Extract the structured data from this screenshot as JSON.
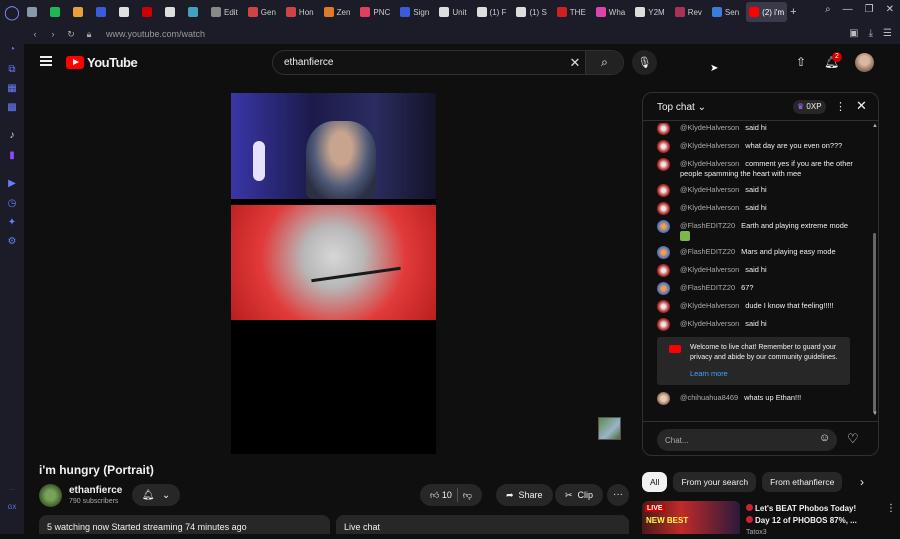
{
  "tabs": [
    {
      "label": "",
      "color": "#8899aa"
    },
    {
      "label": "",
      "color": "#1db954"
    },
    {
      "label": "",
      "color": "#e7a03a"
    },
    {
      "label": "",
      "color": "#3b5bdb"
    },
    {
      "label": "",
      "color": "#e0e0e0"
    },
    {
      "label": "",
      "color": "#cc0000"
    },
    {
      "label": "",
      "color": "#dddddd"
    },
    {
      "label": "",
      "color": "#44a0c0"
    },
    {
      "label": "Edit",
      "color": "#888888"
    },
    {
      "label": "Gen",
      "color": "#cc4444"
    },
    {
      "label": "Hon",
      "color": "#cc4444"
    },
    {
      "label": "Zen",
      "color": "#e07a2a"
    },
    {
      "label": "PNC",
      "color": "#e04060"
    },
    {
      "label": "Sign",
      "color": "#3b5bdb"
    },
    {
      "label": "Unit",
      "color": "#dddddd"
    },
    {
      "label": "(1) F",
      "color": "#dddddd"
    },
    {
      "label": "(1) S",
      "color": "#dddddd"
    },
    {
      "label": "THE",
      "color": "#cc2222"
    },
    {
      "label": "Wha",
      "color": "#dd44aa"
    },
    {
      "label": "Y2M",
      "color": "#dddddd"
    },
    {
      "label": "Rev",
      "color": "#aa3355"
    },
    {
      "label": "Sen",
      "color": "#3b7bdb"
    },
    {
      "label": "(2) i'm",
      "color": "#ff0000",
      "active": true
    }
  ],
  "browser": {
    "url": "www.youtube.com/watch",
    "new_tab": "+"
  },
  "header": {
    "logo_text": "YouTube",
    "search_query": "ethanfierce",
    "notification_count": "2"
  },
  "video": {
    "title": "i'm hungry (Portrait)",
    "channel_name": "ethanfierce",
    "subscribers": "790 subscribers",
    "like_count": "10",
    "share_label": "Share",
    "clip_label": "Clip",
    "stats_text": "5 watching now  Started streaming 74 minutes ago",
    "live_chat_label": "Live chat"
  },
  "chat": {
    "mode_label": "Top chat",
    "xp_label": "0XP",
    "input_placeholder": "Chat...",
    "messages": [
      {
        "author": "@KlydeHalverson",
        "text": "said hi",
        "avatar": "kh"
      },
      {
        "author": "@KlydeHalverson",
        "text": "what day are you even on???",
        "avatar": "kh"
      },
      {
        "author": "@KlydeHalverson",
        "text": "comment yes if you are the other people spamming the heart with mee",
        "avatar": "kh"
      },
      {
        "author": "@KlydeHalverson",
        "text": "said hi",
        "avatar": "kh"
      },
      {
        "author": "@KlydeHalverson",
        "text": "said hi",
        "avatar": "kh"
      },
      {
        "author": "@FlashEDITZ20",
        "text": "Earth and playing extreme mode",
        "avatar": "fe",
        "emoji": true
      },
      {
        "author": "@FlashEDITZ20",
        "text": "Mars and playing easy mode",
        "avatar": "fe"
      },
      {
        "author": "@KlydeHalverson",
        "text": "said hi",
        "avatar": "kh"
      },
      {
        "author": "@FlashEDITZ20",
        "text": "67?",
        "avatar": "fe"
      },
      {
        "author": "@KlydeHalverson",
        "text": "dude I know that feeling!!!!!",
        "avatar": "kh"
      },
      {
        "author": "@KlydeHalverson",
        "text": "said hi",
        "avatar": "kh"
      }
    ],
    "welcome_text": "Welcome to live chat! Remember to guard your privacy and abide by our community guidelines.",
    "learn_more": "Learn more",
    "last_message": {
      "author": "@chihuahua8469",
      "text": "whats up Ethan!!!",
      "avatar": "ch"
    }
  },
  "chips": [
    "All",
    "From your search",
    "From ethanfierce"
  ],
  "recommendation": {
    "badge": "LIVE",
    "thumb_text": "NEW BEST",
    "title_line1": "Let's BEAT Phobos Today!",
    "title_line2": "Day 12 of PHOBOS 87%, ...",
    "channel": "Tatox3"
  },
  "colors": {
    "accent": "#ff0000",
    "link": "#3ea6ff",
    "rail": "#6b7cff"
  }
}
